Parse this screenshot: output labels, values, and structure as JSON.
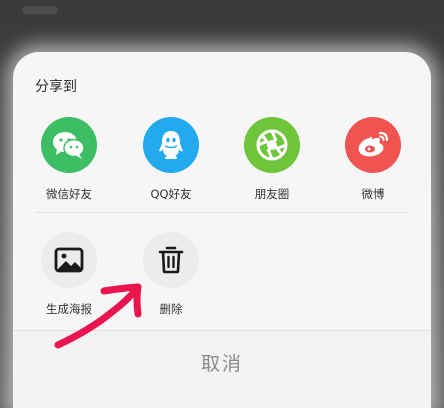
{
  "share_sheet": {
    "title": "分享到",
    "share_targets": [
      {
        "label": "微信好友",
        "icon": "wechat-icon",
        "color": "#3dbe65"
      },
      {
        "label": "QQ好友",
        "icon": "qq-icon",
        "color": "#22a9ee"
      },
      {
        "label": "朋友圈",
        "icon": "moments-icon",
        "color": "#6ec43b"
      },
      {
        "label": "微博",
        "icon": "weibo-icon",
        "color": "#ef5450"
      }
    ],
    "actions": [
      {
        "label": "生成海报",
        "icon": "image-icon",
        "color": "#ececec"
      },
      {
        "label": "删除",
        "icon": "trash-icon",
        "color": "#ececec"
      }
    ],
    "cancel_label": "取消"
  },
  "annotation": {
    "icon": "hand-drawn-arrow-icon",
    "color": "#e8154e"
  }
}
